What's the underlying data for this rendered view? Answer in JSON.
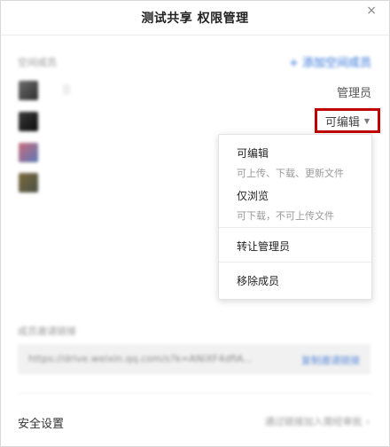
{
  "dialog": {
    "title": "测试共享 权限管理",
    "close_glyph": "×"
  },
  "members": {
    "section_label": "空间成员",
    "add_member_label": "+ 添加空间成员",
    "admin_role_label": "管理员",
    "current_role_label": "可编辑",
    "caret_glyph": "▼"
  },
  "role_menu": {
    "items": [
      {
        "title": "可编辑",
        "desc": "可上传、下载、更新文件"
      },
      {
        "title": "仅浏览",
        "desc": "可下载，不可上传文件"
      },
      {
        "title": "转让管理员"
      },
      {
        "title": "移除成员"
      }
    ]
  },
  "invite": {
    "label": "成员邀请链接",
    "url": "https://drive.weixin.qq.com/s?k=ANiXF4dfiA...",
    "copy_label": "复制邀请链接"
  },
  "security": {
    "label": "安全设置",
    "value": "通过链接加入需经审批",
    "chevron": "›"
  }
}
